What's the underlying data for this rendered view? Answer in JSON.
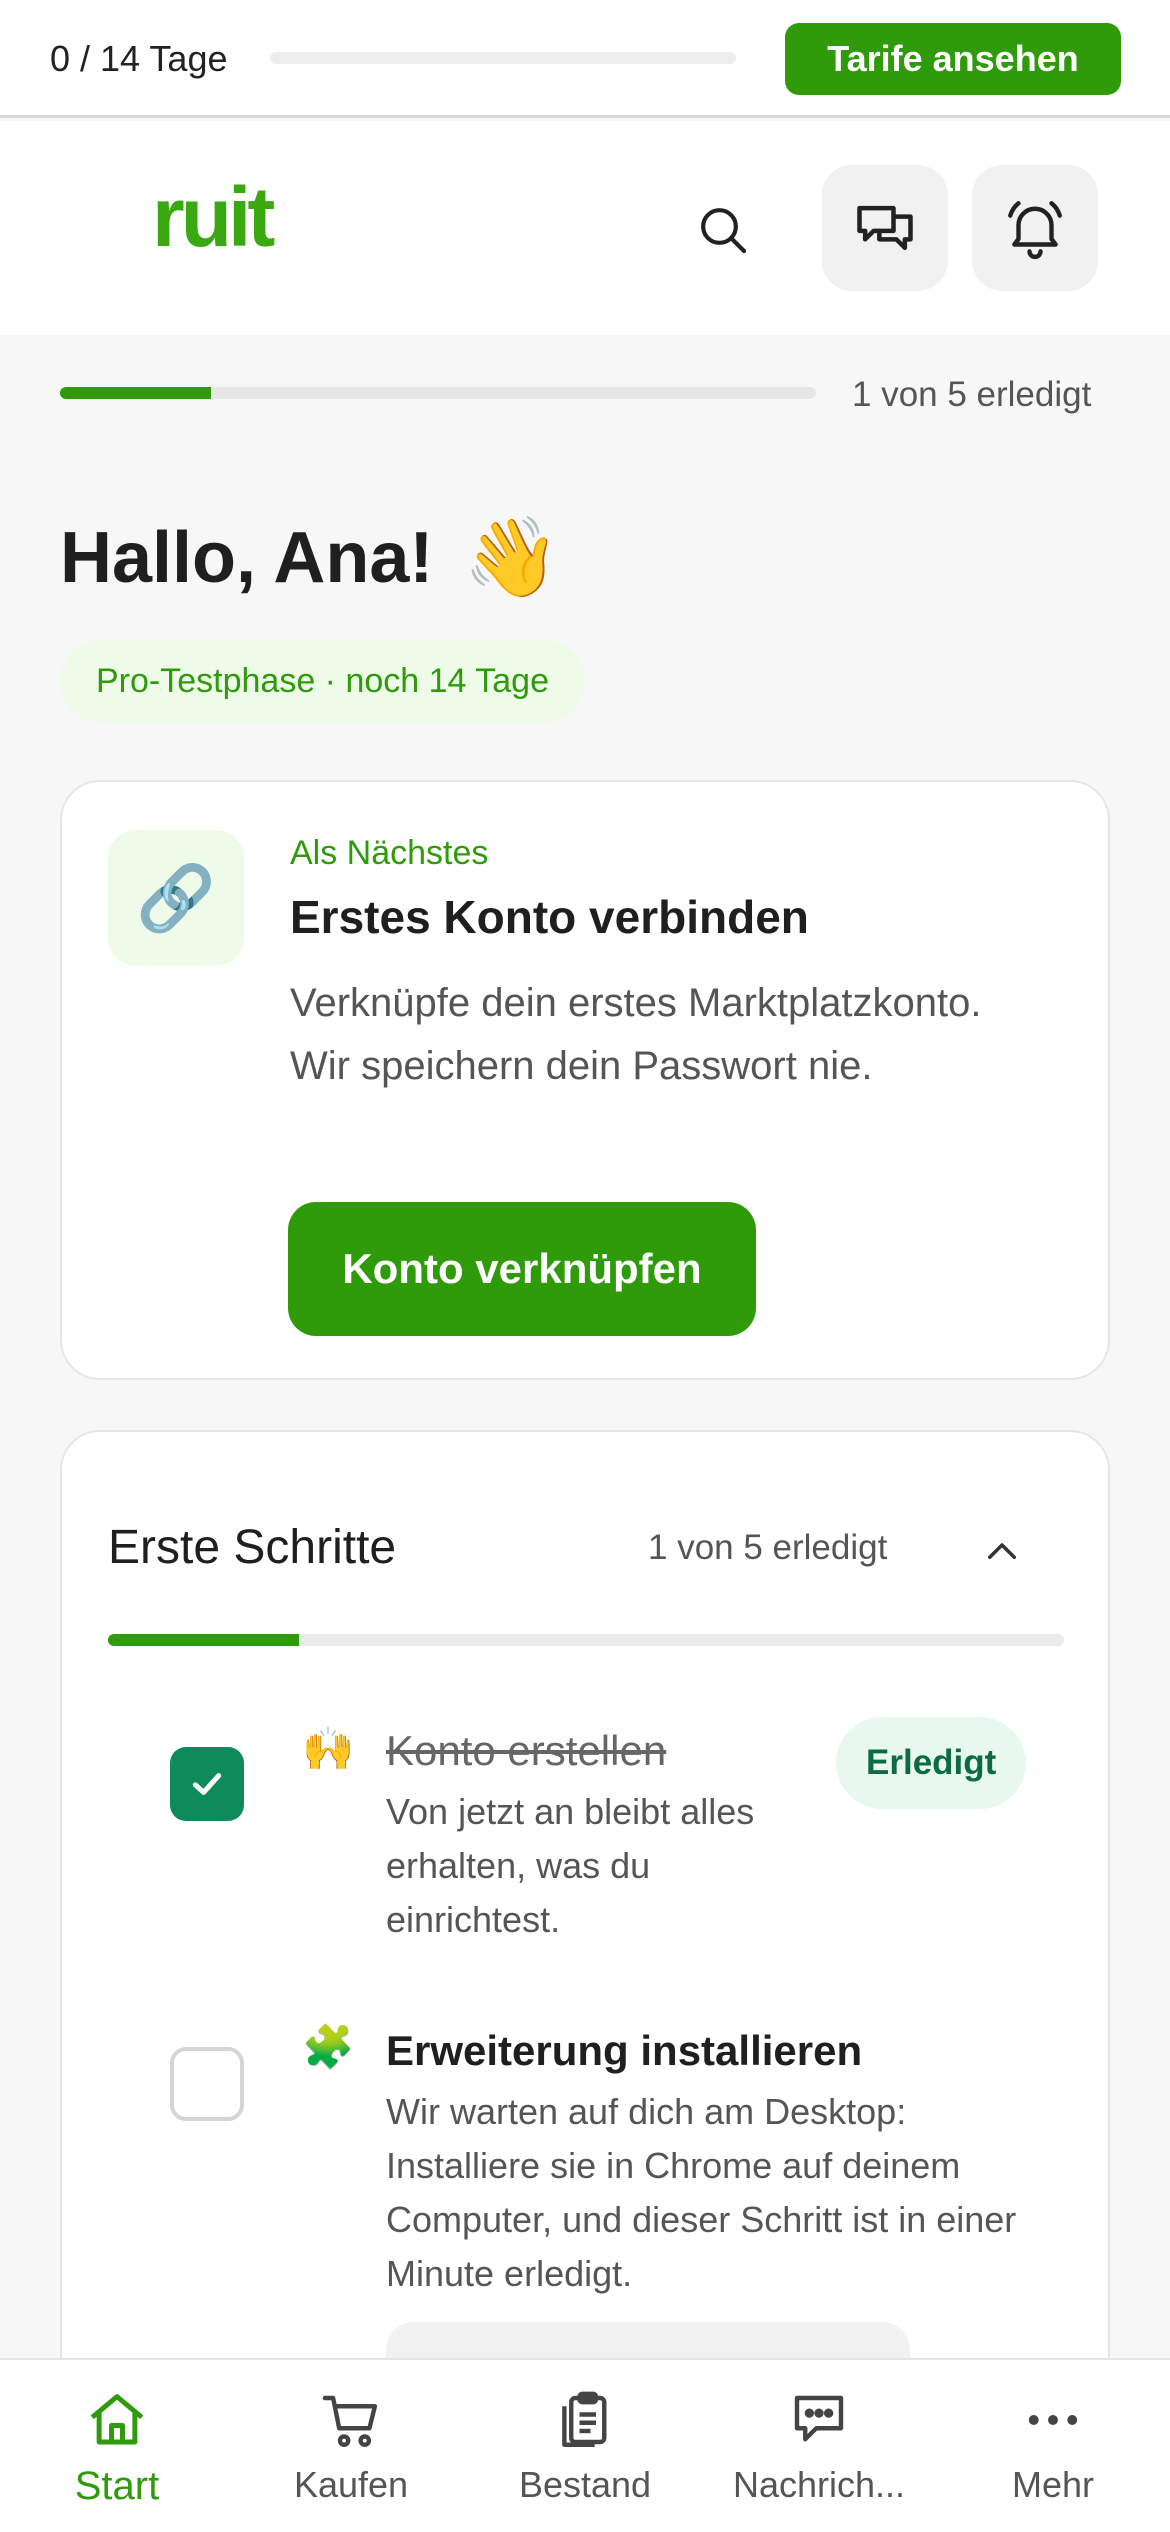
{
  "trial_bar": {
    "counter": "0 / 14 Tage",
    "progress_fraction": 0,
    "plans_button": "Tarife ansehen"
  },
  "header": {
    "logo": "ruit",
    "icons": [
      "search-icon",
      "chat-icon",
      "bell-icon"
    ]
  },
  "onboarding": {
    "progress_label": "1 von 5 erledigt",
    "progress_fraction": 0.2
  },
  "greeting": {
    "text": "Hallo, Ana!",
    "emoji": "👋",
    "trial_pill": "Pro-Testphase · noch 14 Tage"
  },
  "next_step": {
    "icon": "🔗",
    "eyebrow": "Als Nächstes",
    "title": "Erstes Konto verbinden",
    "description": "Verknüpfe dein erstes Marktplatzkonto. Wir speichern dein Passwort nie.",
    "button": "Konto verknüpfen"
  },
  "first_steps": {
    "title": "Erste Schritte",
    "count": "1 von 5 erledigt",
    "progress_fraction": 0.2,
    "items": [
      {
        "emoji": "🙌",
        "title": "Konto erstellen",
        "description": "Von jetzt an bleibt alles erhalten, was du einrichtest.",
        "done": true,
        "badge": "Erledigt"
      },
      {
        "emoji": "🧩",
        "title": "Erweiterung installieren",
        "description": "Wir warten auf dich am Desktop: Installiere sie in Chrome auf deinem Computer, und dieser Schritt ist in einer Minute erledigt.",
        "done": false
      }
    ]
  },
  "bottom_nav": {
    "items": [
      {
        "label": "Start",
        "icon": "home-icon",
        "active": true
      },
      {
        "label": "Kaufen",
        "icon": "cart-icon",
        "active": false
      },
      {
        "label": "Bestand",
        "icon": "clipboard-icon",
        "active": false
      },
      {
        "label": "Nachrich...",
        "icon": "message-icon",
        "active": false
      },
      {
        "label": "Mehr",
        "icon": "more-icon",
        "active": false
      }
    ]
  },
  "colors": {
    "accent": "#2f9a0a",
    "logo": "#3aa810",
    "success": "#0f8a5a",
    "background": "#f7f7f7"
  }
}
